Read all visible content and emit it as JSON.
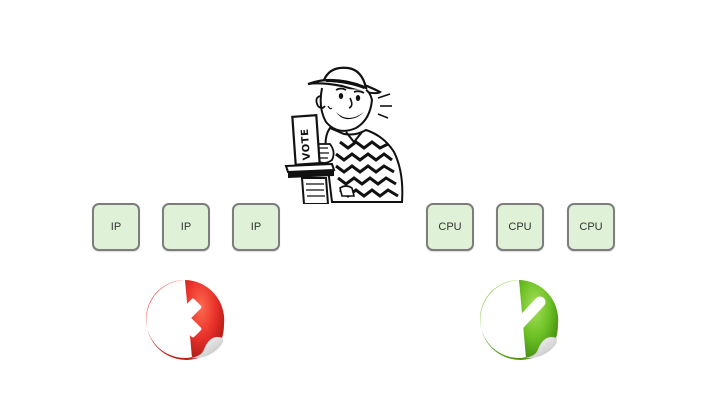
{
  "voter_illustration": {
    "sign_text": "VOTE"
  },
  "left_group": {
    "boxes": [
      {
        "label": "IP"
      },
      {
        "label": "IP"
      },
      {
        "label": "IP"
      }
    ],
    "status_icon": "x-mark-icon",
    "status_color": "#e8312a"
  },
  "right_group": {
    "boxes": [
      {
        "label": "CPU"
      },
      {
        "label": "CPU"
      },
      {
        "label": "CPU"
      }
    ],
    "status_icon": "check-mark-icon",
    "status_color": "#6cc024"
  },
  "colors": {
    "box_fill": "#dff2d7",
    "box_border": "#7d7d7d"
  }
}
